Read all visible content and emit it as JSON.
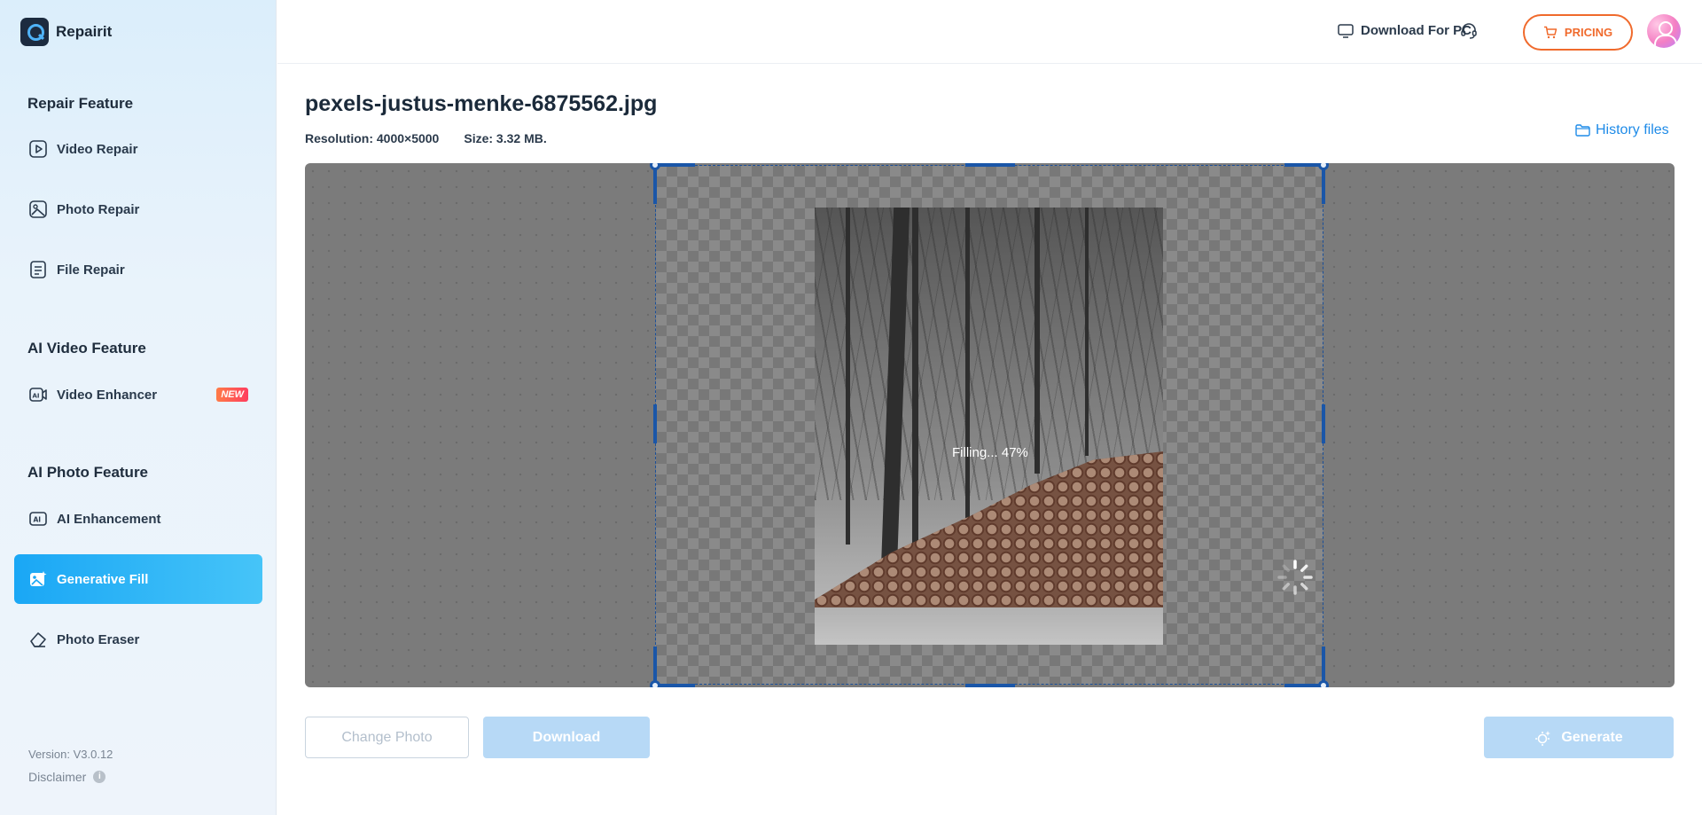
{
  "app": {
    "name": "Repairit"
  },
  "sidebar": {
    "sections": [
      {
        "title": "Repair Feature"
      },
      {
        "title": "AI Video Feature"
      },
      {
        "title": "AI Photo Feature"
      }
    ],
    "items": [
      {
        "label": "Video Repair",
        "icon": "play-icon"
      },
      {
        "label": "Photo Repair",
        "icon": "image-icon"
      },
      {
        "label": "File Repair",
        "icon": "file-icon"
      },
      {
        "label": "Video Enhancer",
        "icon": "video-ai-icon",
        "badge": "NEW"
      },
      {
        "label": "AI Enhancement",
        "icon": "ai-enhance-icon"
      },
      {
        "label": "Generative Fill",
        "icon": "generative-fill-icon",
        "active": true
      },
      {
        "label": "Photo Eraser",
        "icon": "eraser-icon"
      }
    ],
    "version": "Version: V3.0.12",
    "disclaimer": "Disclaimer"
  },
  "topbar": {
    "download_pc": "Download For PC",
    "pricing": "PRICING"
  },
  "main": {
    "file_name": "pexels-justus-menke-6875562.jpg",
    "resolution": "Resolution: 4000×5000",
    "size": "Size: 3.32 MB.",
    "history": "History files",
    "progress_text": "Filling... 47%",
    "progress_percent": 47,
    "buttons": {
      "change_photo": "Change Photo",
      "download": "Download",
      "generate": "Generate"
    }
  },
  "colors": {
    "accent": "#1aa7f5",
    "pricing": "#f06a2c",
    "selection": "#1a56a8",
    "disabled_button": "#b7d9f6"
  }
}
